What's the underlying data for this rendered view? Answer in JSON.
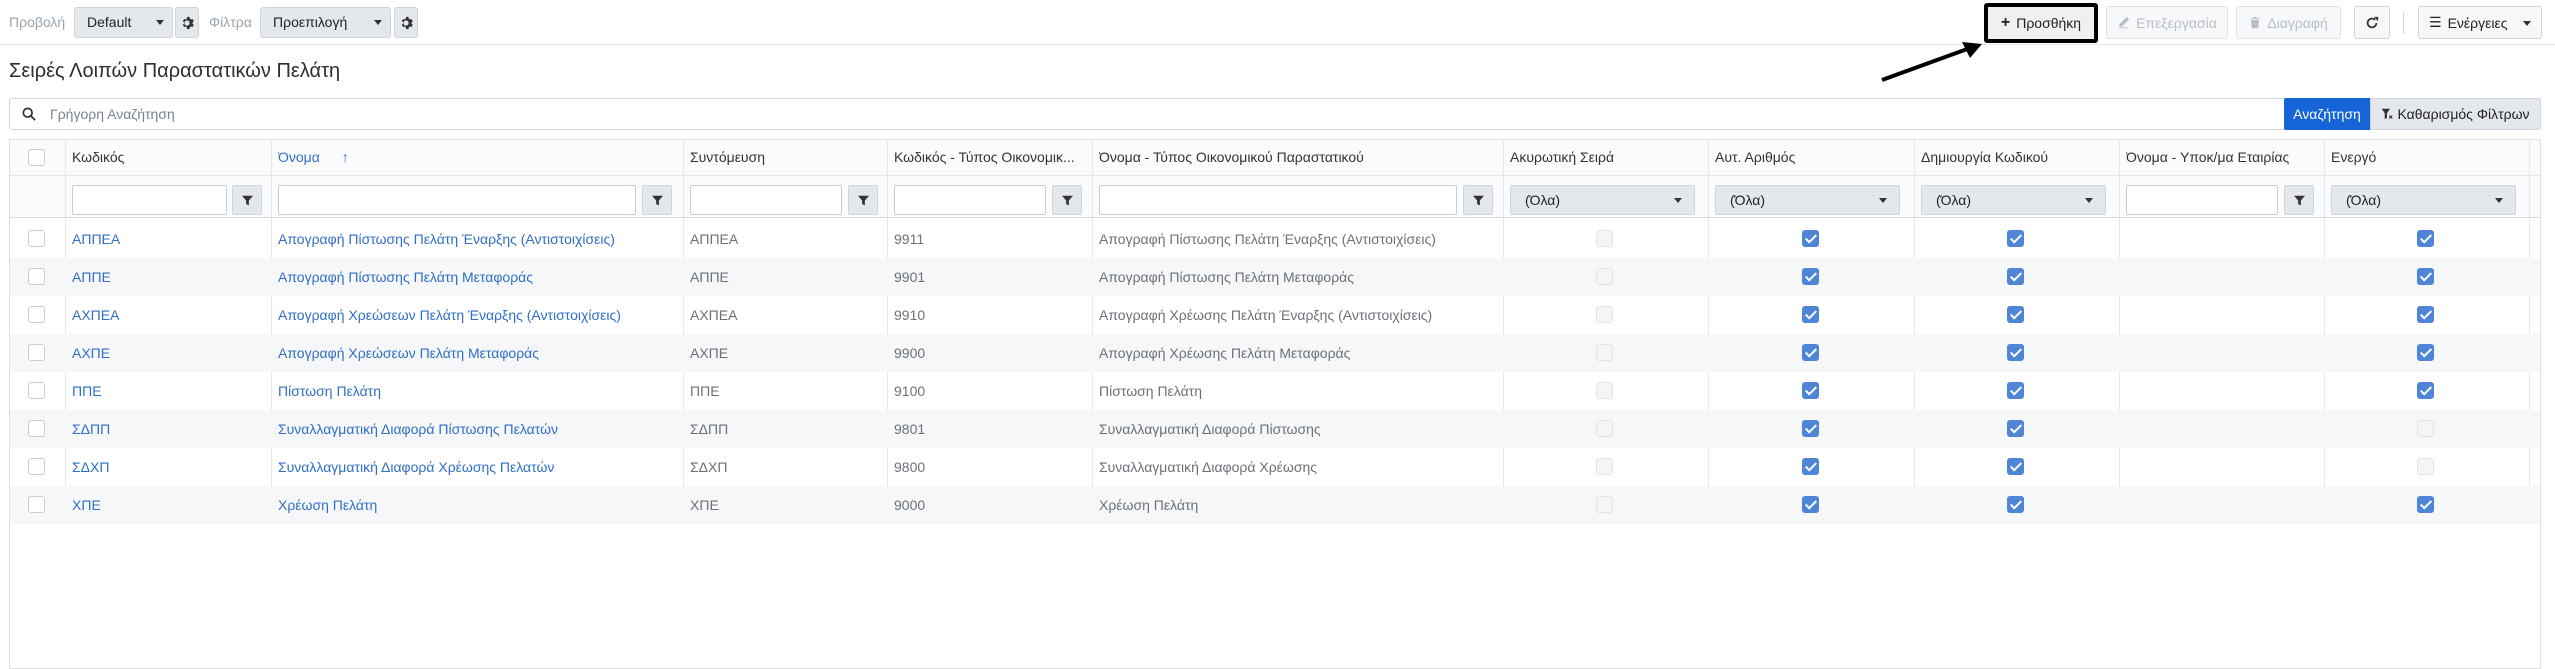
{
  "toolbar": {
    "view_label": "Προβολή",
    "view_value": "Default",
    "filter_label": "Φίλτρα",
    "filter_value": "Προεπιλογή",
    "add_label": "Προσθήκη",
    "edit_label": "Επεξεργασία",
    "delete_label": "Διαγραφή",
    "actions_label": "Ενέργειες"
  },
  "page": {
    "title": "Σειρές Λοιπών Παραστατικών Πελάτη"
  },
  "search": {
    "placeholder": "Γρήγορη Αναζήτηση",
    "search_button": "Αναζήτηση",
    "clear_filters_button": "Καθαρισμός Φίλτρων"
  },
  "grid": {
    "columns": [
      "Κωδικός",
      "Όνομα",
      "Συντόμευση",
      "Κωδικός - Τύπος Οικονομικ...",
      "Όνομα - Τύπος Οικονομικού Παραστατικού",
      "Ακυρωτική Σειρά",
      "Αυτ. Αριθμός",
      "Δημιουργία Κωδικού",
      "Όνομα - Υποκ/μα Εταιρίας",
      "Ενεργό"
    ],
    "sorted_column": "Όνομα",
    "sort_direction": "asc",
    "select_all_option": "(Όλα)",
    "rows": [
      {
        "code": "ΑΠΠΕΑ",
        "name": "Απογραφή Πίστωσης Πελάτη Έναρξης (Αντιστοιχίσεις)",
        "short": "ΑΠΠΕΑ",
        "type_code": "9911",
        "type_name": "Απογραφή Πίστωσης Πελάτη Έναρξης (Αντιστοιχίσεις)",
        "cancel": false,
        "auto": true,
        "create": true,
        "subsidiary": "",
        "active": true
      },
      {
        "code": "ΑΠΠΕ",
        "name": "Απογραφή Πίστωσης Πελάτη Μεταφοράς",
        "short": "ΑΠΠΕ",
        "type_code": "9901",
        "type_name": "Απογραφή Πίστωσης Πελάτη Μεταφοράς",
        "cancel": false,
        "auto": true,
        "create": true,
        "subsidiary": "",
        "active": true
      },
      {
        "code": "ΑΧΠΕΑ",
        "name": "Απογραφή Χρεώσεων Πελάτη Έναρξης (Αντιστοιχίσεις)",
        "short": "ΑΧΠΕΑ",
        "type_code": "9910",
        "type_name": "Απογραφή Χρέωσης Πελάτη Έναρξης (Αντιστοιχίσεις)",
        "cancel": false,
        "auto": true,
        "create": true,
        "subsidiary": "",
        "active": true
      },
      {
        "code": "ΑΧΠΕ",
        "name": "Απογραφή Χρεώσεων Πελάτη Μεταφοράς",
        "short": "ΑΧΠΕ",
        "type_code": "9900",
        "type_name": "Απογραφή Χρέωσης Πελάτη Μεταφοράς",
        "cancel": false,
        "auto": true,
        "create": true,
        "subsidiary": "",
        "active": true
      },
      {
        "code": "ΠΠΕ",
        "name": "Πίστωση Πελάτη",
        "short": "ΠΠΕ",
        "type_code": "9100",
        "type_name": "Πίστωση Πελάτη",
        "cancel": false,
        "auto": true,
        "create": true,
        "subsidiary": "",
        "active": true
      },
      {
        "code": "ΣΔΠΠ",
        "name": "Συναλλαγματική Διαφορά Πίστωσης Πελατών",
        "short": "ΣΔΠΠ",
        "type_code": "9801",
        "type_name": "Συναλλαγματική Διαφορά Πίστωσης",
        "cancel": false,
        "auto": true,
        "create": true,
        "subsidiary": "",
        "active": false
      },
      {
        "code": "ΣΔΧΠ",
        "name": "Συναλλαγματική Διαφορά Χρέωσης Πελατών",
        "short": "ΣΔΧΠ",
        "type_code": "9800",
        "type_name": "Συναλλαγματική Διαφορά Χρέωσης",
        "cancel": false,
        "auto": true,
        "create": true,
        "subsidiary": "",
        "active": false
      },
      {
        "code": "ΧΠΕ",
        "name": "Χρέωση Πελάτη",
        "short": "ΧΠΕ",
        "type_code": "9000",
        "type_name": "Χρέωση Πελάτη",
        "cancel": false,
        "auto": true,
        "create": true,
        "subsidiary": "",
        "active": true
      }
    ]
  },
  "colors": {
    "accent": "#1565d8",
    "link": "#2f6fc7",
    "checked": "#4f85d6"
  }
}
